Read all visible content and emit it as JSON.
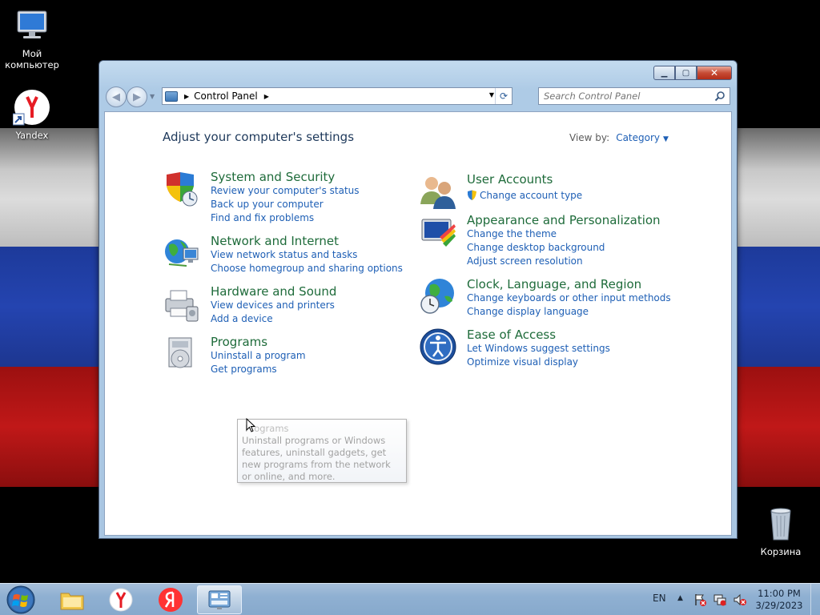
{
  "desktop": {
    "icons": [
      {
        "label": "Мой компьютер"
      },
      {
        "label": "Yandex"
      },
      {
        "label": "Корзина"
      }
    ]
  },
  "window": {
    "address": {
      "crumb": "Control Panel"
    },
    "search": {
      "placeholder": "Search Control Panel"
    },
    "heading": "Adjust your computer's settings",
    "view_by": {
      "label": "View by:",
      "value": "Category"
    },
    "categories": {
      "system_security": {
        "title": "System and Security",
        "links": [
          "Review your computer's status",
          "Back up your computer",
          "Find and fix problems"
        ]
      },
      "network": {
        "title": "Network and Internet",
        "links": [
          "View network status and tasks",
          "Choose homegroup and sharing options"
        ]
      },
      "hardware": {
        "title": "Hardware and Sound",
        "links": [
          "View devices and printers",
          "Add a device"
        ]
      },
      "programs": {
        "title": "Programs",
        "links": [
          "Uninstall a program",
          "Get programs"
        ]
      },
      "user_accounts": {
        "title": "User Accounts",
        "links": [
          "Change account type"
        ]
      },
      "appearance": {
        "title": "Appearance and Personalization",
        "links": [
          "Change the theme",
          "Change desktop background",
          "Adjust screen resolution"
        ]
      },
      "clock": {
        "title": "Clock, Language, and Region",
        "links": [
          "Change keyboards or other input methods",
          "Change display language"
        ]
      },
      "ease": {
        "title": "Ease of Access",
        "links": [
          "Let Windows suggest settings",
          "Optimize visual display"
        ]
      }
    },
    "tooltip": {
      "title": "Programs",
      "text": "Uninstall programs or Windows features, uninstall gadgets, get new programs from the network or online, and more."
    }
  },
  "taskbar": {
    "lang": "EN",
    "time": "11:00 PM",
    "date": "3/29/2023"
  },
  "colors": {
    "category_title": "#1e6b3a",
    "link": "#1e5fb5",
    "heading": "#1e395b"
  }
}
